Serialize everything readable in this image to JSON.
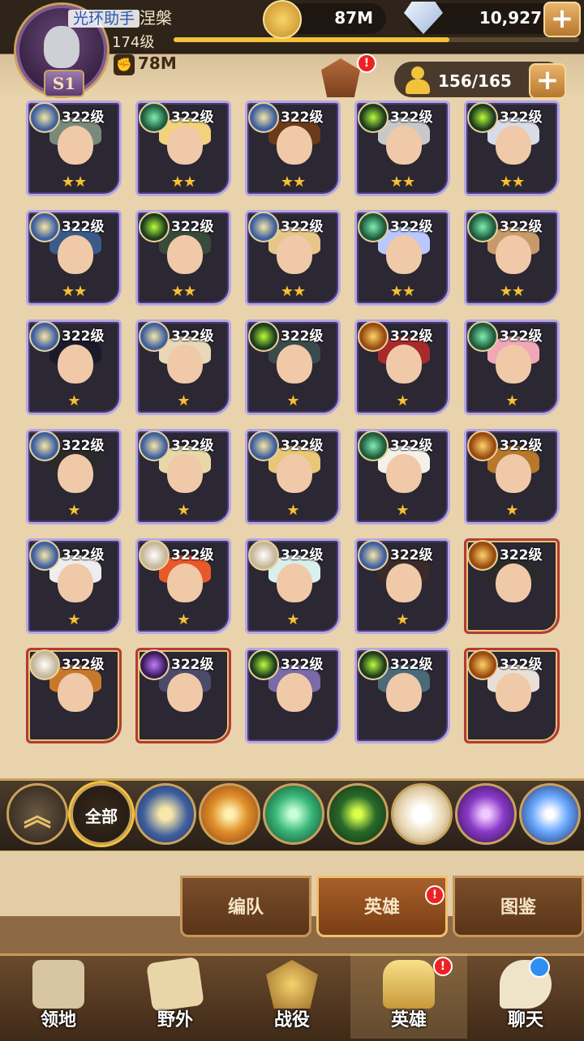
{
  "player": {
    "name_tag": "光环助手",
    "name": "涅槃",
    "level": "174级",
    "season": "S1",
    "power": "78M",
    "xp_fraction": 0.68
  },
  "currency": {
    "gold": "87M",
    "diamonds": "10,927"
  },
  "hero_capacity": "156/165",
  "heroes": [
    {
      "level": "322级",
      "stars": "★★",
      "faction": "light",
      "frame": "purple",
      "hair": "#7a8a7a"
    },
    {
      "level": "322级",
      "stars": "★★",
      "faction": "wild",
      "frame": "purple",
      "hair": "#f0d37a"
    },
    {
      "level": "322级",
      "stars": "★★",
      "faction": "light",
      "frame": "purple",
      "hair": "#6a3a1a"
    },
    {
      "level": "322级",
      "stars": "★★",
      "faction": "grave",
      "frame": "purple",
      "hair": "#c8c8c8"
    },
    {
      "level": "322级",
      "stars": "★★",
      "faction": "grave",
      "frame": "purple",
      "hair": "#d8dbe8"
    },
    {
      "level": "322级",
      "stars": "★★",
      "faction": "light",
      "frame": "purple",
      "hair": "#3a5a8a"
    },
    {
      "level": "322级",
      "stars": "★★",
      "faction": "grave",
      "frame": "purple",
      "hair": "#3a4a3a"
    },
    {
      "level": "322级",
      "stars": "★★",
      "faction": "light",
      "frame": "purple",
      "hair": "#e8c68a"
    },
    {
      "level": "322级",
      "stars": "★★",
      "faction": "wild",
      "frame": "purple",
      "hair": "#b8c8ff"
    },
    {
      "level": "322级",
      "stars": "★★",
      "faction": "wild",
      "frame": "purple",
      "hair": "#c89a6a"
    },
    {
      "level": "322级",
      "stars": "★",
      "faction": "light",
      "frame": "purple",
      "hair": "#1a1a2a"
    },
    {
      "level": "322级",
      "stars": "★",
      "faction": "light",
      "frame": "purple",
      "hair": "#e8d8b8"
    },
    {
      "level": "322级",
      "stars": "★",
      "faction": "grave",
      "frame": "purple",
      "hair": "#3a4a4a"
    },
    {
      "level": "322级",
      "stars": "★",
      "faction": "maul",
      "frame": "purple",
      "hair": "#a82a2a"
    },
    {
      "level": "322级",
      "stars": "★",
      "faction": "wild",
      "frame": "purple",
      "hair": "#f0a8b8"
    },
    {
      "level": "322级",
      "stars": "★",
      "faction": "light",
      "frame": "purple",
      "hair": "#2a2a2a"
    },
    {
      "level": "322级",
      "stars": "★",
      "faction": "light",
      "frame": "purple",
      "hair": "#e8d8a8"
    },
    {
      "level": "322级",
      "stars": "★",
      "faction": "light",
      "frame": "purple",
      "hair": "#e8c878"
    },
    {
      "level": "322级",
      "stars": "★",
      "faction": "wild",
      "frame": "purple",
      "hair": "#f4f0ea"
    },
    {
      "level": "322级",
      "stars": "★",
      "faction": "maul",
      "frame": "purple",
      "hair": "#b8782a"
    },
    {
      "level": "322级",
      "stars": "★",
      "faction": "light",
      "frame": "purple",
      "hair": "#eeeeee"
    },
    {
      "level": "322级",
      "stars": "★",
      "faction": "celestial",
      "frame": "purple",
      "hair": "#e8582a"
    },
    {
      "level": "322级",
      "stars": "★",
      "faction": "celestial",
      "frame": "purple",
      "hair": "#d8f0ee"
    },
    {
      "level": "322级",
      "stars": "★",
      "faction": "light",
      "frame": "purple",
      "hair": "#3a2a2a"
    },
    {
      "level": "322级",
      "stars": "",
      "faction": "maul",
      "frame": "red",
      "hair": "#2a2a2a"
    },
    {
      "level": "322级",
      "stars": "",
      "faction": "celestial",
      "frame": "red",
      "hair": "#c8782a"
    },
    {
      "level": "322级",
      "stars": "",
      "faction": "hypogean",
      "frame": "red",
      "hair": "#4a4a6a"
    },
    {
      "level": "322级",
      "stars": "",
      "faction": "grave",
      "frame": "purple",
      "hair": "#7a6aa8"
    },
    {
      "level": "322级",
      "stars": "",
      "faction": "grave",
      "frame": "purple",
      "hair": "#4a6a7a"
    },
    {
      "level": "322级",
      "stars": "",
      "faction": "maul",
      "frame": "red",
      "hair": "#e8e0d8"
    }
  ],
  "filters": [
    {
      "name": "collapse",
      "label": ""
    },
    {
      "name": "all",
      "label": "全部"
    },
    {
      "name": "lightbearer",
      "label": ""
    },
    {
      "name": "mauler",
      "label": ""
    },
    {
      "name": "wilder",
      "label": ""
    },
    {
      "name": "graveborn",
      "label": ""
    },
    {
      "name": "celestial",
      "label": ""
    },
    {
      "name": "hypogean",
      "label": ""
    },
    {
      "name": "dimensional",
      "label": ""
    }
  ],
  "sub_tabs": [
    {
      "label": "编队"
    },
    {
      "label": "英雄"
    },
    {
      "label": "图鉴"
    }
  ],
  "nav": [
    {
      "label": "领地",
      "icon": "castle-icon"
    },
    {
      "label": "野外",
      "icon": "map-scroll-icon"
    },
    {
      "label": "战役",
      "icon": "sword-shield-icon"
    },
    {
      "label": "英雄",
      "icon": "helmet-icon"
    },
    {
      "label": "聊天",
      "icon": "chat-icon"
    }
  ],
  "badges": {
    "alert": "!"
  }
}
